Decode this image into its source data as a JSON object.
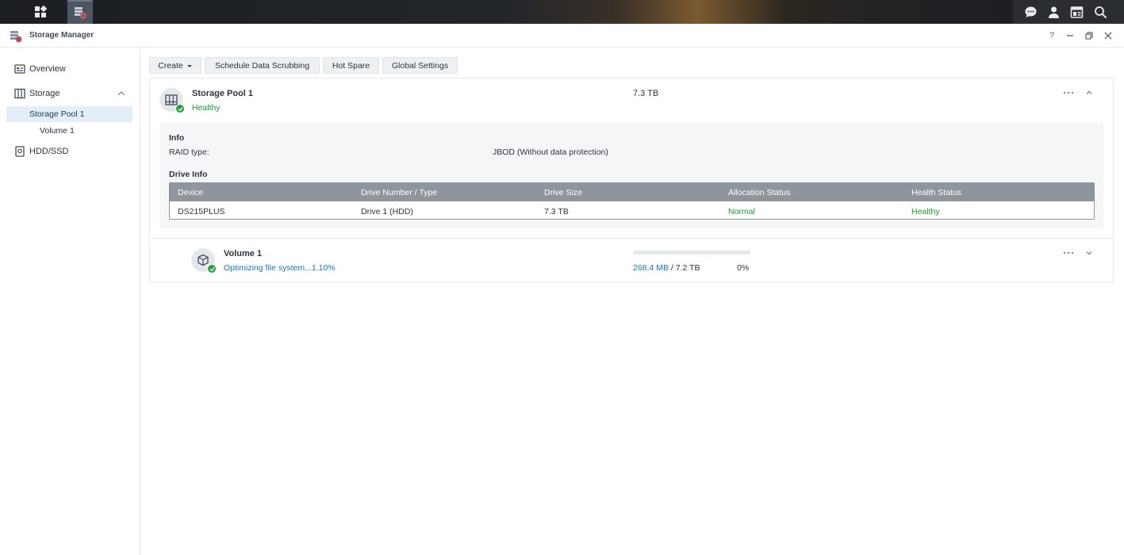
{
  "window": {
    "title": "Storage Manager"
  },
  "sidebar": {
    "overview": "Overview",
    "storage": "Storage",
    "storage_pool": "Storage Pool 1",
    "volume": "Volume 1",
    "hdd_ssd": "HDD/SSD"
  },
  "toolbar": {
    "create": "Create",
    "scrubbing": "Schedule Data Scrubbing",
    "hot_spare": "Hot Spare",
    "global_settings": "Global Settings"
  },
  "pool": {
    "name": "Storage Pool 1",
    "status": "Healthy",
    "size": "7.3 TB",
    "info_heading": "Info",
    "raid_label": "RAID type:",
    "raid_value": "JBOD (Without data protection)",
    "drive_info_heading": "Drive Info",
    "columns": [
      "Device",
      "Drive Number / Type",
      "Drive Size",
      "Allocation Status",
      "Health Status"
    ],
    "drives": [
      {
        "device": "DS215PLUS",
        "number_type": "Drive 1 (HDD)",
        "size": "7.3 TB",
        "allocation": "Normal",
        "health": "Healthy"
      }
    ]
  },
  "volume": {
    "name": "Volume 1",
    "status": "Optimizing file system...1.10%",
    "used": "268.4 MB",
    "separator": "/",
    "total": "7.2 TB",
    "percent": "0%",
    "progress_fraction": 0.0
  },
  "colors": {
    "healthy": "#1e9a31",
    "link": "#1a73c9",
    "selected_bg": "#e3eef9"
  },
  "icons": [
    "main-menu-icon",
    "storage-manager-icon",
    "chat-icon",
    "user-icon",
    "widgets-icon",
    "search-icon",
    "help-icon",
    "minimize-icon",
    "restore-icon",
    "close-icon",
    "overview-icon",
    "storage-icon",
    "hdd-icon",
    "pool-icon",
    "volume-icon",
    "check-icon",
    "more-icon",
    "chevron-up-icon",
    "chevron-down-icon",
    "caret-down-icon"
  ]
}
